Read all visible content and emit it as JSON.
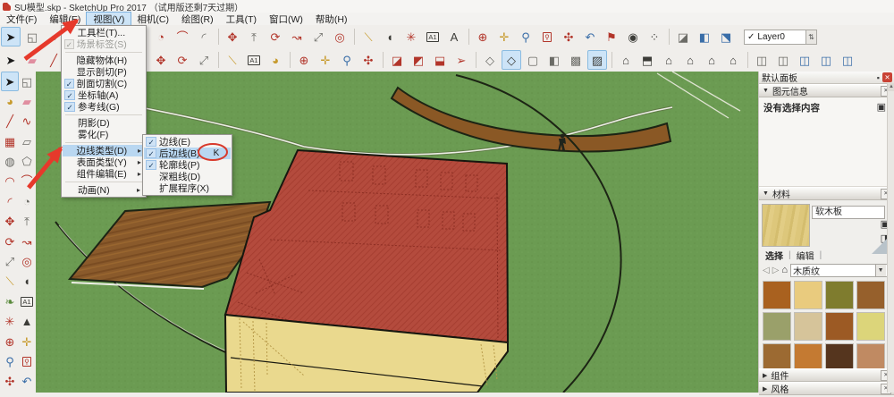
{
  "title_bar": {
    "title": "SU模型.skp - SketchUp Pro 2017 （试用版还剩7天过期）"
  },
  "menu_bar": {
    "items": [
      {
        "label": "文件(F)"
      },
      {
        "label": "编辑(E)"
      },
      {
        "label": "视图(V)",
        "active": true
      },
      {
        "label": "相机(C)"
      },
      {
        "label": "绘图(R)"
      },
      {
        "label": "工具(T)"
      },
      {
        "label": "窗口(W)"
      },
      {
        "label": "帮助(H)"
      }
    ]
  },
  "view_menu": {
    "items": [
      {
        "n": "toolbars",
        "label": "工具栏(T)..."
      },
      {
        "n": "scene-tabs",
        "label": "场景标签(S)",
        "checked": true,
        "grayed": true
      },
      {
        "sep": true
      },
      {
        "n": "hidden-geometry",
        "label": "隐藏物体(H)"
      },
      {
        "n": "section-planes",
        "label": "显示剖切(P)"
      },
      {
        "n": "section-cuts",
        "label": "剖面切割(C)",
        "checked": true
      },
      {
        "n": "axes",
        "label": "坐标轴(A)",
        "checked": true
      },
      {
        "n": "guides",
        "label": "参考线(G)",
        "checked": true
      },
      {
        "sep": true
      },
      {
        "n": "shadows",
        "label": "阴影(D)"
      },
      {
        "n": "fog",
        "label": "雾化(F)"
      },
      {
        "sep": true
      },
      {
        "n": "edge-style",
        "label": "边线类型(D)",
        "hl": true,
        "sub": true
      },
      {
        "n": "face-style",
        "label": "表面类型(Y)",
        "sub": true
      },
      {
        "n": "component-edit",
        "label": "组件编辑(E)",
        "sub": true
      },
      {
        "sep": true
      },
      {
        "n": "animation",
        "label": "动画(N)",
        "sub": true
      }
    ]
  },
  "edge_submenu": {
    "items": [
      {
        "n": "edges",
        "label": "边线(E)",
        "checked": true
      },
      {
        "n": "back-edges",
        "label": "后边线(B)",
        "checked": true,
        "hl": true,
        "badge": "K"
      },
      {
        "n": "profiles",
        "label": "轮廓线(P)",
        "checked": true
      },
      {
        "n": "depth-cue",
        "label": "深粗线(D)"
      },
      {
        "n": "extension",
        "label": "扩展程序(X)"
      }
    ]
  },
  "toolbar": {
    "layer_value": "Layer0"
  },
  "toolbar_row1": [
    {
      "n": "select",
      "g": "➤",
      "c": "#1a1a1a",
      "hl": true
    },
    {
      "n": "make-component",
      "g": "◱",
      "c": "#6b6b66"
    },
    {
      "n": "paint-bucket",
      "g": "◕",
      "c": "#6b6b66"
    },
    {
      "n": "rectangle",
      "g": "▦",
      "c": "#b2352a"
    },
    {
      "n": "circle",
      "g": "◍",
      "c": "#6b6b66"
    },
    {
      "n": "polygon",
      "g": "⬠",
      "c": "#6b6b66"
    },
    {
      "n": "arc",
      "g": "◠",
      "c": "#b2352a"
    },
    {
      "n": "pie",
      "g": "◔",
      "c": "#b2352a"
    },
    {
      "n": "two-point-arc",
      "g": "⌒",
      "c": "#b2352a"
    },
    {
      "n": "three-point-arc",
      "g": "◜",
      "c": "#6b6b66"
    },
    {
      "sep": true
    },
    {
      "n": "move",
      "g": "✥",
      "c": "#b2352a"
    },
    {
      "n": "push-pull",
      "g": "⤒",
      "c": "#6b6b66"
    },
    {
      "n": "rotate",
      "g": "⟳",
      "c": "#b2352a"
    },
    {
      "n": "follow-me",
      "g": "↝",
      "c": "#b2352a"
    },
    {
      "n": "scale",
      "g": "⤢",
      "c": "#6b6b66"
    },
    {
      "n": "offset",
      "g": "◎",
      "c": "#b2352a"
    },
    {
      "sep": true
    },
    {
      "n": "tape-measure",
      "g": "⟍",
      "c": "#c79a2c"
    },
    {
      "n": "protractor",
      "g": "◖",
      "c": "#3c3c38"
    },
    {
      "n": "axes",
      "g": "✳",
      "c": "#b2352a"
    },
    {
      "n": "dimension",
      "g": "A1",
      "c": "#3c3c38",
      "box": true
    },
    {
      "n": "3d-text",
      "g": "A",
      "c": "#3c3c38"
    },
    {
      "sep": true
    },
    {
      "n": "orbit",
      "g": "⊕",
      "c": "#b2352a"
    },
    {
      "n": "pan",
      "g": "✛",
      "c": "#c79a2c"
    },
    {
      "n": "zoom",
      "g": "⚲",
      "c": "#3a6ea8"
    },
    {
      "n": "zoom-window",
      "g": "⚲",
      "c": "#b2352a",
      "box": true
    },
    {
      "n": "zoom-extents",
      "g": "✣",
      "c": "#b2352a"
    },
    {
      "n": "previous",
      "g": "↶",
      "c": "#3a6ea8"
    },
    {
      "n": "position-camera",
      "g": "⚑",
      "c": "#b2352a"
    },
    {
      "n": "look-around",
      "g": "◉",
      "c": "#3c3c38"
    },
    {
      "n": "walk",
      "g": "⁘",
      "c": "#3c3c38"
    },
    {
      "sep": true
    },
    {
      "n": "section-plane",
      "g": "◪",
      "c": "#6b6b66"
    },
    {
      "n": "section-fill",
      "g": "◧",
      "c": "#3a6ea8"
    },
    {
      "n": "section-display",
      "g": "⬔",
      "c": "#3a6ea8"
    }
  ],
  "toolbar_row2": [
    {
      "n": "select",
      "g": "➤",
      "c": "#1a1a1a"
    },
    {
      "n": "eraser",
      "g": "▰",
      "c": "#e08ea0"
    },
    {
      "n": "line",
      "g": "╱",
      "c": "#b2352a"
    },
    {
      "n": "freehand",
      "g": "∿",
      "c": "#b2352a"
    },
    {
      "n": "rotated-rectangle",
      "g": "▱",
      "c": "#6b6b66"
    },
    {
      "n": "push-pull",
      "g": "⤒",
      "c": "#6b6b66"
    },
    {
      "n": "follow-me",
      "g": "↝",
      "c": "#b2352a"
    },
    {
      "n": "move",
      "g": "✥",
      "c": "#b2352a"
    },
    {
      "n": "rotate",
      "g": "⟳",
      "c": "#b2352a"
    },
    {
      "n": "scale",
      "g": "⤢",
      "c": "#6b6b66"
    },
    {
      "sep": true
    },
    {
      "n": "tape-measure",
      "g": "⟍",
      "c": "#c79a2c"
    },
    {
      "n": "dimension",
      "g": "A1",
      "c": "#3c3c38",
      "box": true
    },
    {
      "n": "paint-bucket",
      "g": "◕",
      "c": "#c79a2c"
    },
    {
      "sep": true
    },
    {
      "n": "orbit",
      "g": "⊕",
      "c": "#b2352a"
    },
    {
      "n": "pan",
      "g": "✛",
      "c": "#c79a2c"
    },
    {
      "n": "zoom",
      "g": "⚲",
      "c": "#3a6ea8"
    },
    {
      "n": "zoom-extents",
      "g": "✣",
      "c": "#b2352a"
    },
    {
      "sep": true
    },
    {
      "n": "section-plane",
      "g": "◪",
      "c": "#b2352a"
    },
    {
      "n": "section-fill",
      "g": "◩",
      "c": "#b2352a"
    },
    {
      "n": "section-display",
      "g": "⬓",
      "c": "#b2352a"
    },
    {
      "n": "position-pin",
      "g": "➢",
      "c": "#b2352a"
    },
    {
      "sep": true
    },
    {
      "n": "xray",
      "g": "◇",
      "c": "#6b6b66"
    },
    {
      "n": "wireframe",
      "g": "◇",
      "c": "#3c3c38",
      "hl": true
    },
    {
      "n": "hidden-line",
      "g": "▢",
      "c": "#6b6b66"
    },
    {
      "n": "shaded",
      "g": "◧",
      "c": "#6b6b66"
    },
    {
      "n": "textured",
      "g": "▩",
      "c": "#6b6b66"
    },
    {
      "n": "monochrome",
      "g": "▨",
      "c": "#3c3c38",
      "hl": true
    },
    {
      "sep": true
    },
    {
      "n": "iso-view",
      "g": "⌂",
      "c": "#3c3c38"
    },
    {
      "n": "top-view",
      "g": "⬒",
      "c": "#3c3c38"
    },
    {
      "n": "front-view",
      "g": "⌂",
      "c": "#3c3c38"
    },
    {
      "n": "right-view",
      "g": "⌂",
      "c": "#3c3c38"
    },
    {
      "n": "left-view",
      "g": "⌂",
      "c": "#3c3c38"
    },
    {
      "n": "back-view",
      "g": "⌂",
      "c": "#3c3c38"
    },
    {
      "sep": true
    },
    {
      "n": "section-style-1",
      "g": "◫",
      "c": "#6b6b66"
    },
    {
      "n": "section-style-2",
      "g": "◫",
      "c": "#6b6b66"
    },
    {
      "n": "section-style-3",
      "g": "◫",
      "c": "#3a6ea8"
    },
    {
      "n": "section-style-4",
      "g": "◫",
      "c": "#3a6ea8"
    },
    {
      "n": "section-style-5",
      "g": "◫",
      "c": "#3a6ea8"
    }
  ],
  "left_toolbar": [
    {
      "n": "select",
      "g": "➤",
      "c": "#1a1a1a",
      "hl": true
    },
    {
      "n": "make-component",
      "g": "◱",
      "c": "#6b6b66"
    },
    {
      "n": "paint-bucket",
      "g": "◕",
      "c": "#c79a2c"
    },
    {
      "n": "eraser",
      "g": "▰",
      "c": "#e08ea0"
    },
    {
      "n": "line",
      "g": "╱",
      "c": "#b2352a"
    },
    {
      "n": "freehand",
      "g": "∿",
      "c": "#b2352a"
    },
    {
      "n": "rectangle",
      "g": "▦",
      "c": "#b2352a"
    },
    {
      "n": "rotated-rectangle",
      "g": "▱",
      "c": "#6b6b66"
    },
    {
      "n": "circle",
      "g": "◍",
      "c": "#6b6b66"
    },
    {
      "n": "polygon",
      "g": "⬠",
      "c": "#6b6b66"
    },
    {
      "n": "arc",
      "g": "◠",
      "c": "#b2352a"
    },
    {
      "n": "two-point-arc",
      "g": "⌒",
      "c": "#b2352a"
    },
    {
      "n": "three-point-arc",
      "g": "◜",
      "c": "#b2352a"
    },
    {
      "n": "pie",
      "g": "◔",
      "c": "#6b6b66"
    },
    {
      "n": "move",
      "g": "✥",
      "c": "#b2352a"
    },
    {
      "n": "push-pull",
      "g": "⤒",
      "c": "#6b6b66"
    },
    {
      "n": "rotate",
      "g": "⟳",
      "c": "#b2352a"
    },
    {
      "n": "follow-me",
      "g": "↝",
      "c": "#b2352a"
    },
    {
      "n": "scale",
      "g": "⤢",
      "c": "#6b6b66"
    },
    {
      "n": "offset",
      "g": "◎",
      "c": "#b2352a"
    },
    {
      "n": "tape-measure",
      "g": "⟍",
      "c": "#c79a2c"
    },
    {
      "n": "protractor",
      "g": "◖",
      "c": "#3c3c38"
    },
    {
      "n": "paint-leaf",
      "g": "❧",
      "c": "#5a8a3c"
    },
    {
      "n": "dimension",
      "g": "A1",
      "c": "#3c3c38",
      "box": true
    },
    {
      "n": "axes",
      "g": "✳",
      "c": "#b2352a"
    },
    {
      "n": "3d-text",
      "g": "▲",
      "c": "#3c3c38"
    },
    {
      "n": "orbit",
      "g": "⊕",
      "c": "#b2352a"
    },
    {
      "n": "pan",
      "g": "✛",
      "c": "#c79a2c"
    },
    {
      "n": "zoom",
      "g": "⚲",
      "c": "#3a6ea8"
    },
    {
      "n": "zoom-window",
      "g": "⚲",
      "c": "#b2352a",
      "box": true
    },
    {
      "n": "zoom-extents",
      "g": "✣",
      "c": "#b2352a"
    },
    {
      "n": "previous",
      "g": "↶",
      "c": "#3a6ea8"
    }
  ],
  "right_panel": {
    "header": "默认面板",
    "entity_info": {
      "title": "图元信息",
      "message": "没有选择内容"
    },
    "materials": {
      "title": "材料",
      "material_name": "软木板",
      "tabs": [
        {
          "label": "选择",
          "on": true
        },
        {
          "label": "编辑"
        }
      ],
      "category": "木质纹",
      "swatches": [
        {
          "n": "wood-1",
          "c": "#a9611f"
        },
        {
          "n": "wood-2",
          "c": "#e9cb7e"
        },
        {
          "n": "wood-3",
          "c": "#7f7c2e"
        },
        {
          "n": "wood-4",
          "c": "#96602c"
        },
        {
          "n": "wood-5",
          "c": "#9aa06a"
        },
        {
          "n": "wood-6",
          "c": "#d6c49a"
        },
        {
          "n": "wood-7",
          "c": "#9c5a24"
        },
        {
          "n": "wood-8",
          "c": "#dcd57a"
        },
        {
          "n": "wood-9",
          "c": "#9c6a32"
        },
        {
          "n": "wood-10",
          "c": "#c47a32"
        },
        {
          "n": "wood-11",
          "c": "#55351e"
        },
        {
          "n": "wood-12",
          "c": "#c08a62"
        }
      ]
    },
    "components": {
      "title": "组件"
    },
    "styles": {
      "title": "风格"
    }
  },
  "icons": {
    "check": "✓",
    "close": "✕",
    "pin": "▪",
    "scroll_up": "▲",
    "collapse": "▼",
    "expand": "▶",
    "submenu_arrow": "▸",
    "eyedropper": "✐",
    "home": "⌂",
    "back": "◁",
    "forward": "▷",
    "flip": "⬗",
    "in_model": "▣",
    "create_material": "◨",
    "dropdown": "▼",
    "tab_separator": "|",
    "entity_box": "▣",
    "spinner": "⇅"
  },
  "colors": {
    "canvas_green": "#6b9b52",
    "building_red": "#b44b3d",
    "building_yellow": "#ead98e",
    "terrain_brown": "#8a5825",
    "wood_deck": "#8a5a2b",
    "annotation_red": "#e6392b",
    "menu_highlight": "#b9d7f1",
    "toolbar_highlight": "#cde4f7"
  }
}
